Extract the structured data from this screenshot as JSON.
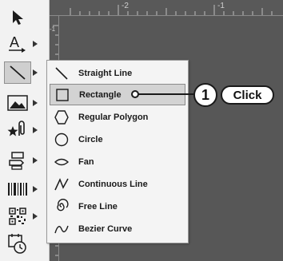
{
  "toolbar": {
    "tools": [
      {
        "name": "select",
        "icon": "cursor-arrow-icon"
      },
      {
        "name": "text",
        "icon": "text-a-icon"
      },
      {
        "name": "line",
        "icon": "line-tool-icon"
      },
      {
        "name": "image",
        "icon": "image-icon"
      },
      {
        "name": "clipart",
        "icon": "clipart-icon"
      },
      {
        "name": "flowchart",
        "icon": "flowchart-icon"
      },
      {
        "name": "barcode",
        "icon": "barcode-icon"
      },
      {
        "name": "qrcode",
        "icon": "qrcode-icon"
      },
      {
        "name": "datetime",
        "icon": "calendar-clock-icon"
      }
    ]
  },
  "ruler": {
    "top_labels": [
      "-2",
      "-1"
    ],
    "left_labels": [
      "-1"
    ]
  },
  "menu": {
    "items": [
      {
        "label": "Straight Line",
        "icon": "straight-line-icon"
      },
      {
        "label": "Rectangle",
        "icon": "rectangle-icon",
        "selected": true
      },
      {
        "label": "Regular Polygon",
        "icon": "polygon-icon"
      },
      {
        "label": "Circle",
        "icon": "circle-icon"
      },
      {
        "label": "Fan",
        "icon": "fan-icon"
      },
      {
        "label": "Continuous Line",
        "icon": "continuous-line-icon"
      },
      {
        "label": "Free Line",
        "icon": "free-line-icon"
      },
      {
        "label": "Bezier Curve",
        "icon": "bezier-curve-icon"
      }
    ]
  },
  "callout": {
    "number": "1",
    "label": "Click"
  },
  "colors": {
    "canvas": "#575757",
    "toolbar": "#f2f2f2",
    "menu": "#f4f4f4",
    "selected": "#d3d3d3"
  }
}
